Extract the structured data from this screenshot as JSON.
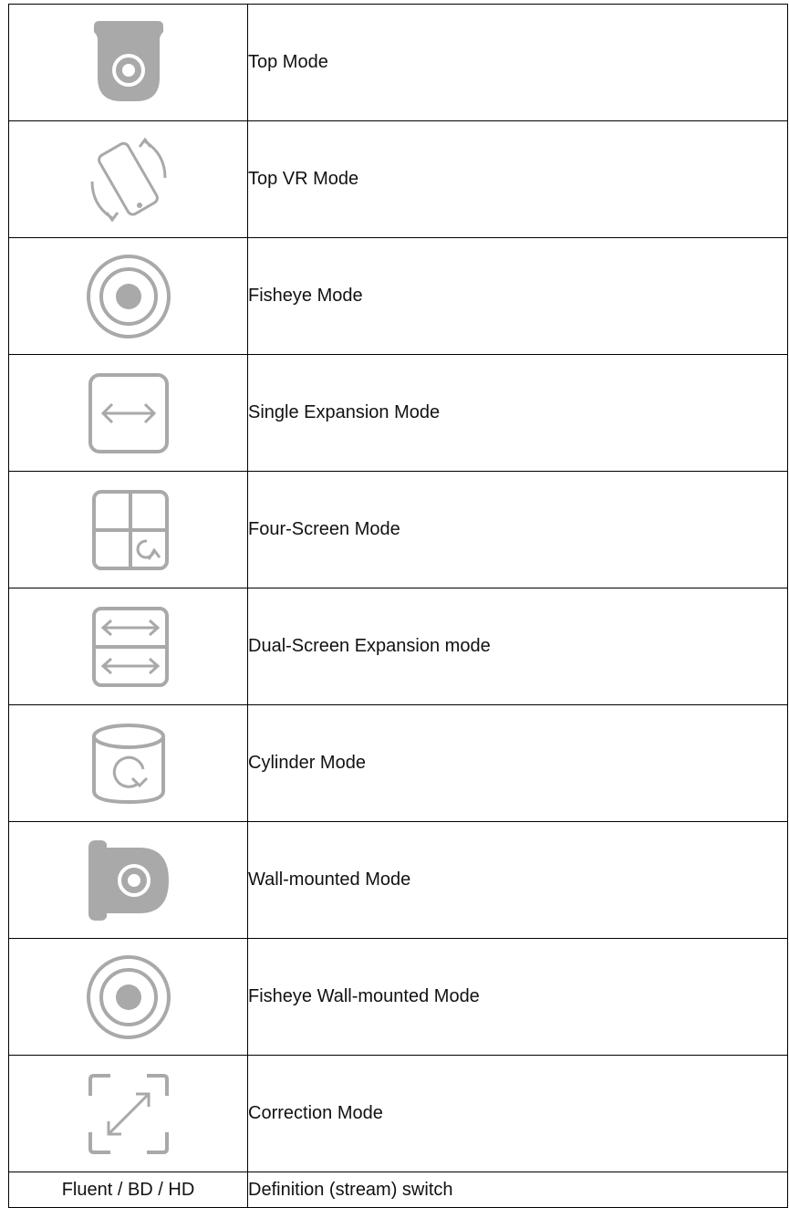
{
  "colors": {
    "icon_gray": "#a9a9a9",
    "border": "#000000"
  },
  "rows": [
    {
      "icon": "dome-camera-icon",
      "label": "Top Mode"
    },
    {
      "icon": "rotate-phone-icon",
      "label": "Top VR Mode"
    },
    {
      "icon": "fisheye-icon",
      "label": "Fisheye Mode"
    },
    {
      "icon": "expand-arrows-icon",
      "label": "Single Expansion Mode"
    },
    {
      "icon": "quad-screen-icon",
      "label": "Four-Screen Mode"
    },
    {
      "icon": "dual-expansion-icon",
      "label": "Dual-Screen Expansion mode"
    },
    {
      "icon": "cylinder-icon",
      "label": "Cylinder Mode"
    },
    {
      "icon": "wall-camera-icon",
      "label": "Wall-mounted Mode"
    },
    {
      "icon": "fisheye-wall-icon",
      "label": "Fisheye Wall-mounted Mode"
    },
    {
      "icon": "correction-icon",
      "label": "Correction Mode"
    }
  ],
  "last_row": {
    "left": "Fluent / BD / HD",
    "right": "Definition (stream) switch"
  }
}
